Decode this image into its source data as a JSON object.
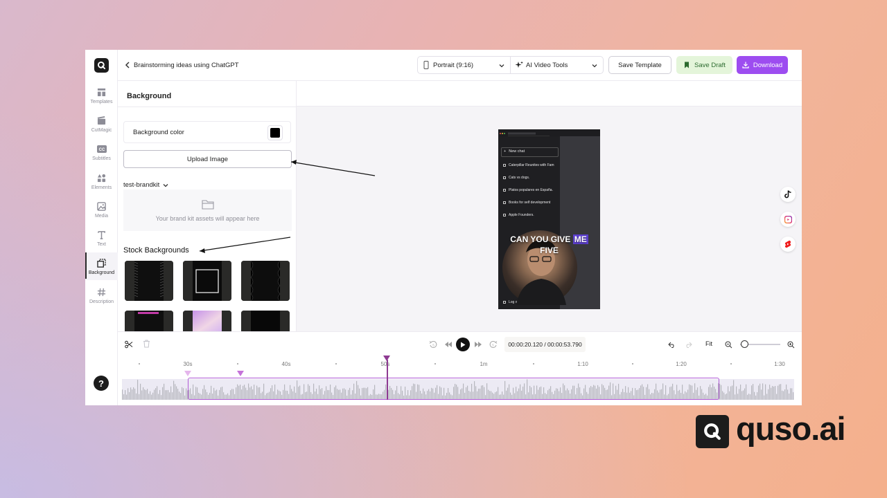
{
  "topbar": {
    "project_title": "Brainstorming ideas using ChatGPT",
    "aspect_select": "Portrait (9:16)",
    "tools_select": "AI Video Tools",
    "save_template": "Save Template",
    "save_draft": "Save Draft",
    "download": "Download"
  },
  "rail": {
    "items": [
      {
        "label": "Templates",
        "icon": "templates-icon"
      },
      {
        "label": "CutMagic",
        "icon": "cutmagic-icon"
      },
      {
        "label": "Subtitles",
        "icon": "cc-icon"
      },
      {
        "label": "Elements",
        "icon": "elements-icon"
      },
      {
        "label": "Media",
        "icon": "image-icon"
      },
      {
        "label": "Text",
        "icon": "text-icon"
      },
      {
        "label": "Background",
        "icon": "background-icon",
        "active": true
      },
      {
        "label": "Description",
        "icon": "hash-icon"
      }
    ],
    "help": "?"
  },
  "panel": {
    "title": "Background",
    "bg_color_label": "Background color",
    "bg_color_value": "#000000",
    "upload_label": "Upload Image",
    "brandkit_label": "test-brandkit",
    "brandkit_empty": "Your brand kit assets will appear here",
    "stock_title": "Stock Backgrounds"
  },
  "preview": {
    "sidebar_items": [
      "New chat",
      "Caterpillar Reunites with Fam",
      "Cats vs dogs.",
      "Platos populares en España.",
      "Books for self development",
      "Apple Founders."
    ],
    "logout": "Log out",
    "caption_line1_plain": "CAN YOU GIVE ",
    "caption_line1_highlight": "ME",
    "caption_line2": "FIVE"
  },
  "timeline": {
    "current_time": "00:00:20.120",
    "total_time": "/ 00:00:53.790",
    "fit_label": "Fit",
    "ruler_labels": [
      "30s",
      "40s",
      "50s",
      "1m",
      "1:10",
      "1:20",
      "1:30"
    ],
    "playhead_progress": 0.374
  },
  "brand": {
    "name": "quso.ai"
  },
  "colors": {
    "accent": "#9d4df0",
    "draft_bg": "#e4f5da",
    "playhead": "#8e3a92",
    "clip_border": "#b15ad6"
  }
}
